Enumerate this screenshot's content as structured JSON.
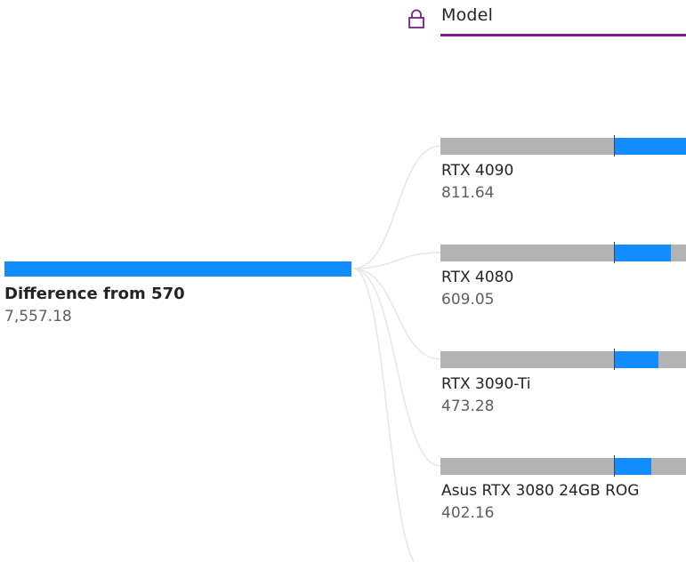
{
  "header": {
    "title": "Model",
    "icon": "lock-icon",
    "accent_color": "#7b1e8a"
  },
  "chart_data": {
    "type": "decomposition-tree",
    "root": {
      "label": "Difference from 570",
      "value_text": "7,557.18",
      "value": 7557.18
    },
    "nodes": [
      {
        "label": "RTX 4090",
        "value_text": "811.64",
        "value": 811.64
      },
      {
        "label": "RTX 4080",
        "value_text": "609.05",
        "value": 609.05
      },
      {
        "label": "RTX 3090-Ti",
        "value_text": "473.28",
        "value": 473.28
      },
      {
        "label": "Asus RTX 3080 24GB ROG",
        "value_text": "402.16",
        "value": 402.16
      }
    ],
    "colors": {
      "positive": "#118dff",
      "track": "#b3b3b3",
      "connector": "#e6e6e6"
    }
  }
}
